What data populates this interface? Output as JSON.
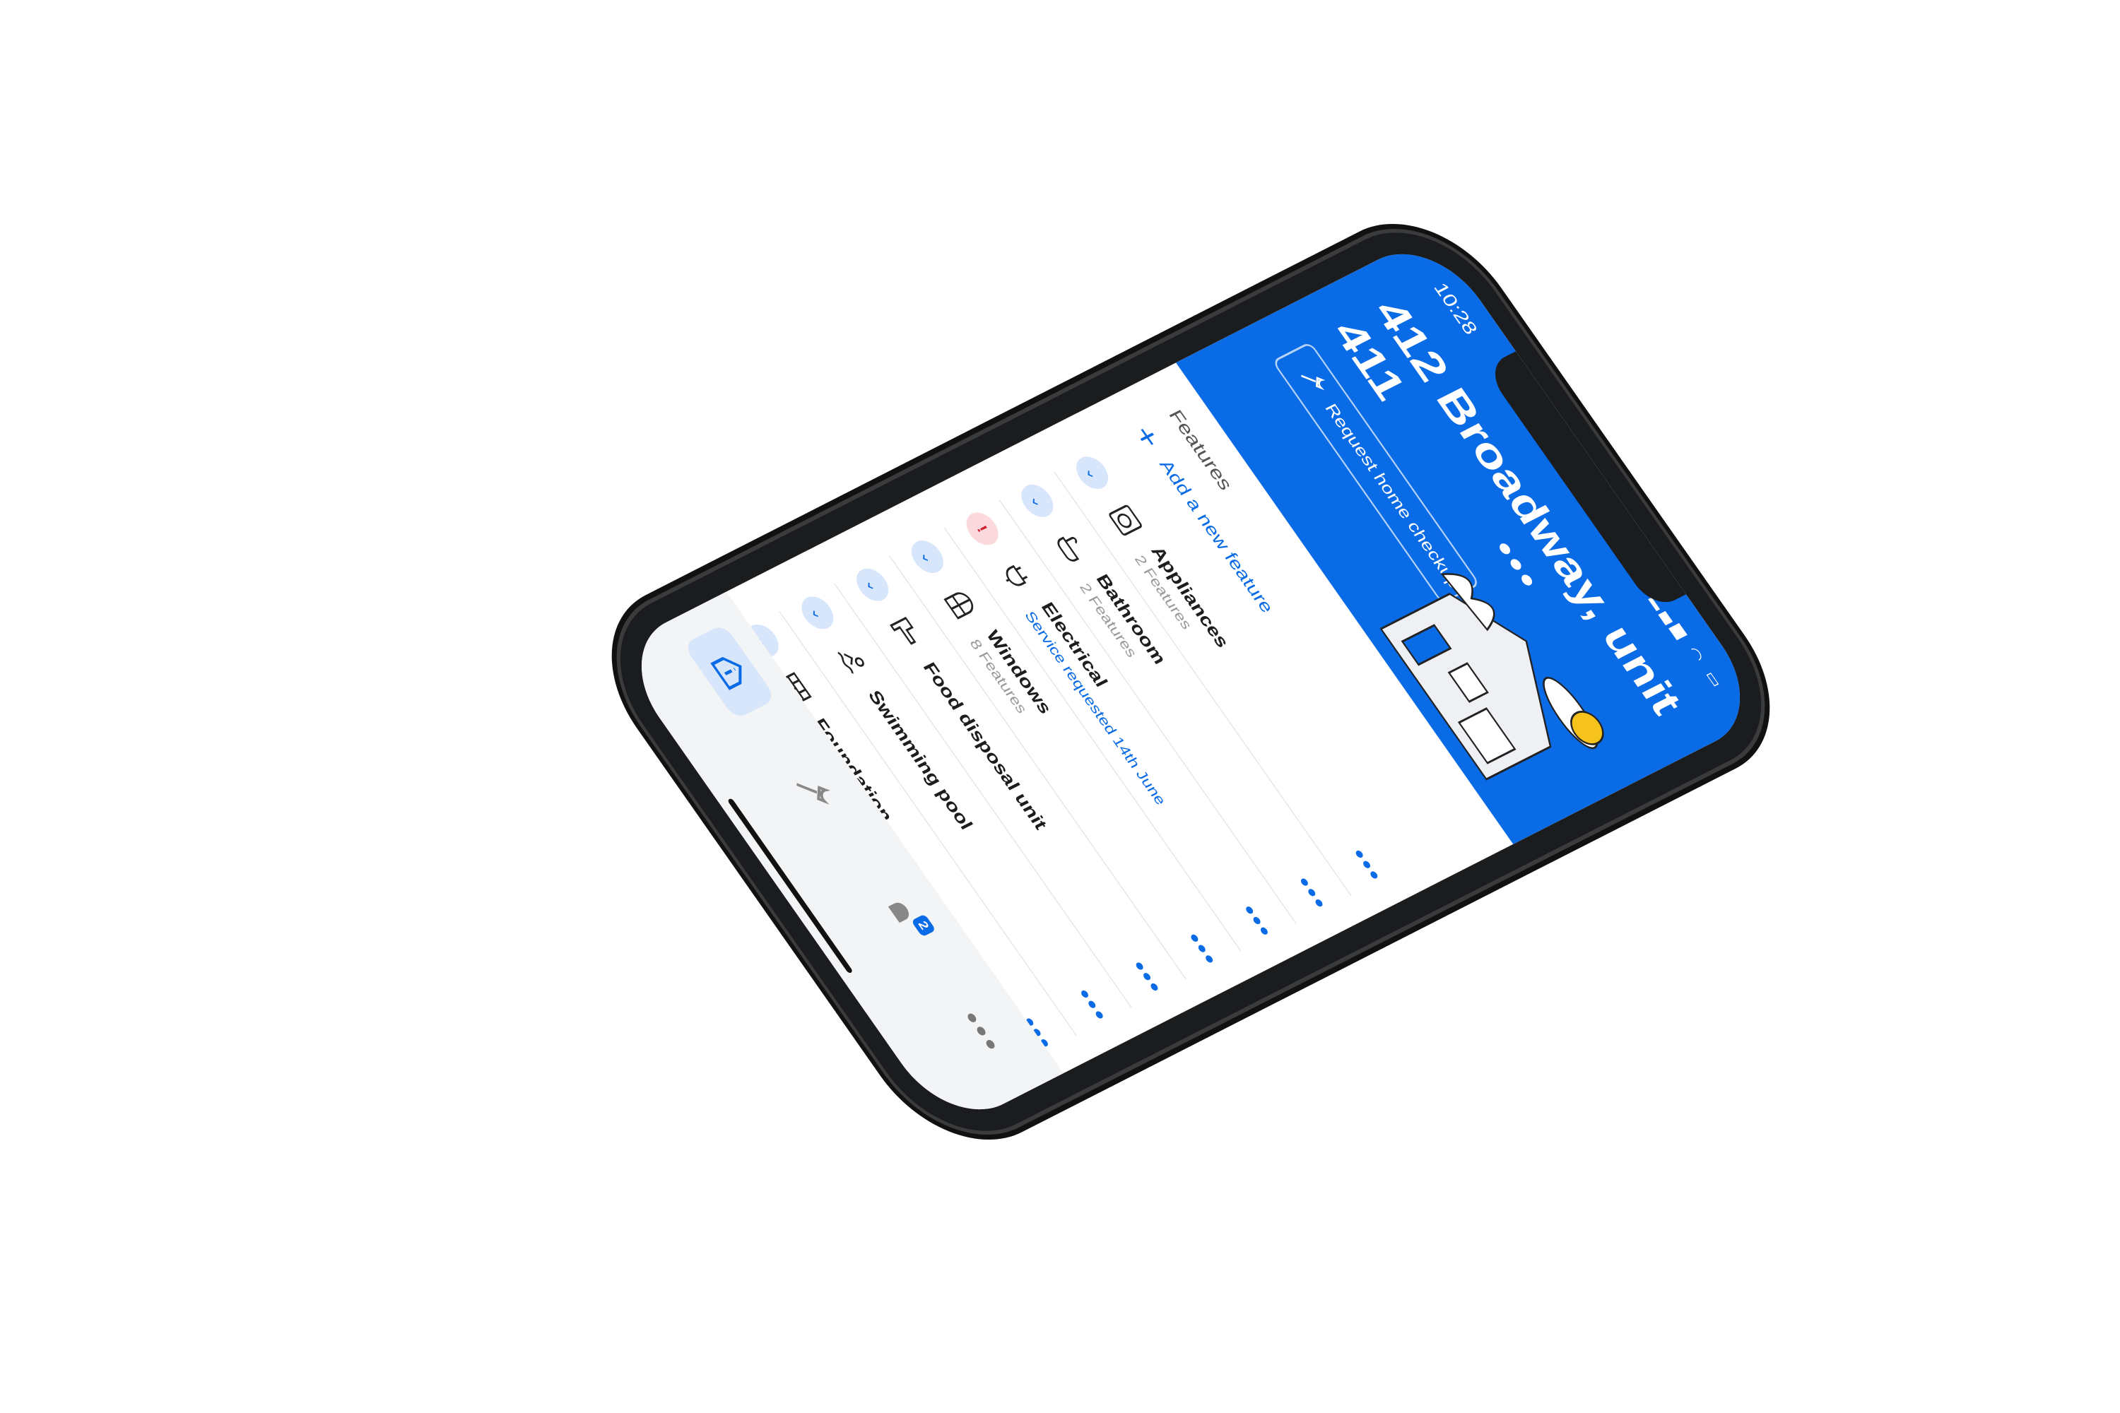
{
  "status": {
    "time": "10:28"
  },
  "header": {
    "address": "412 Broadway, unit 411",
    "checkup_label": "Request home checkup"
  },
  "features": {
    "title": "Features",
    "add_label": "Add a new feature",
    "items": [
      {
        "name": "Appliances",
        "sub": "2 Features",
        "status": "ok",
        "icon": "washing-machine-icon"
      },
      {
        "name": "Bathroom",
        "sub": "2 Features",
        "status": "ok",
        "icon": "bathtub-icon"
      },
      {
        "name": "Electrical",
        "sub": "Service requested 14th June",
        "status": "alert",
        "icon": "plug-icon"
      },
      {
        "name": "Windows",
        "sub": "8 Features",
        "status": "ok",
        "icon": "window-icon"
      },
      {
        "name": "Food disposal unit",
        "sub": "",
        "status": "ok",
        "icon": "pipe-icon"
      },
      {
        "name": "Swimming pool",
        "sub": "",
        "status": "ok",
        "icon": "swimmer-icon"
      },
      {
        "name": "Foundation",
        "sub": "",
        "status": "ok",
        "icon": "bricks-icon"
      }
    ]
  },
  "tabbar": {
    "notifications_badge": "2"
  },
  "colors": {
    "accent": "#0a6be6",
    "alert": "#d0202e"
  }
}
